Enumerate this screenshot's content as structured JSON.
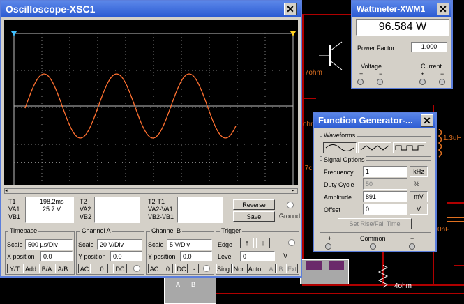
{
  "oscilloscope": {
    "title": "Oscilloscope-XSC1",
    "readout": {
      "t1_label": "T1",
      "va1_label": "VA1",
      "vb1_label": "VB1",
      "t1_value": "198.2ms",
      "va1_value": "25.7 V",
      "vb1_value": "",
      "t2_label": "T2",
      "va2_label": "VA2",
      "vb2_label": "VB2",
      "t2t1_label": "T2-T1",
      "va2va1_label": "VA2-VA1",
      "vb2vb1_label": "VB2-VB1"
    },
    "buttons": {
      "reverse": "Reverse",
      "save": "Save",
      "ground": "Ground"
    },
    "timebase": {
      "title": "Timebase",
      "scale_label": "Scale",
      "scale_value": "500 µs/Div",
      "xpos_label": "X position",
      "xpos_value": "0.0",
      "modes": [
        "Y/T",
        "Add",
        "B/A",
        "A/B"
      ]
    },
    "channel_a": {
      "title": "Channel A",
      "scale_label": "Scale",
      "scale_value": "20 V/Div",
      "ypos_label": "Y position",
      "ypos_value": "0.0",
      "coupling": [
        "AC",
        "0",
        "DC"
      ]
    },
    "channel_b": {
      "title": "Channel B",
      "scale_label": "Scale",
      "scale_value": "5 V/Div",
      "ypos_label": "Y position",
      "ypos_value": "0.0",
      "coupling": [
        "AC",
        "0",
        "DC",
        "-"
      ]
    },
    "trigger": {
      "title": "Trigger",
      "edge_label": "Edge",
      "level_label": "Level",
      "level_value": "0",
      "level_unit": "V",
      "modes": [
        "Sing.",
        "Nor.",
        "Auto"
      ],
      "sources": [
        "A",
        "B",
        "Ext"
      ]
    },
    "trace_color": "#ff7030"
  },
  "wattmeter": {
    "title": "Wattmeter-XWM1",
    "display": "96.584 W",
    "pf_label": "Power Factor:",
    "pf_value": "1.000",
    "voltage_label": "Voltage",
    "current_label": "Current",
    "plus": "+",
    "minus": "−"
  },
  "function_generator": {
    "title": "Function Generator-...",
    "waveforms_label": "Waveforms",
    "signal_options_label": "Signal Options",
    "frequency_label": "Frequency",
    "frequency_value": "1",
    "frequency_unit": "kHz",
    "duty_label": "Duty Cycle",
    "duty_value": "50",
    "duty_unit": "%",
    "amplitude_label": "Amplitude",
    "amplitude_value": "891",
    "amplitude_unit": "mV",
    "offset_label": "Offset",
    "offset_value": "0",
    "offset_unit": "V",
    "rise_fall_button": "Set Rise/Fall Time",
    "plus": "+",
    "common": "Common",
    "minus": "−"
  },
  "schematic": {
    "label_7ohm_top": ".7ohm",
    "label_ohm": "ohm",
    "label_7ohm_mid": ".7c",
    "label_inductor": "1.3uH",
    "label_cap": "0nF",
    "label_4ohm": "4ohm",
    "scope_icon_a": "A",
    "scope_icon_b": "B"
  }
}
